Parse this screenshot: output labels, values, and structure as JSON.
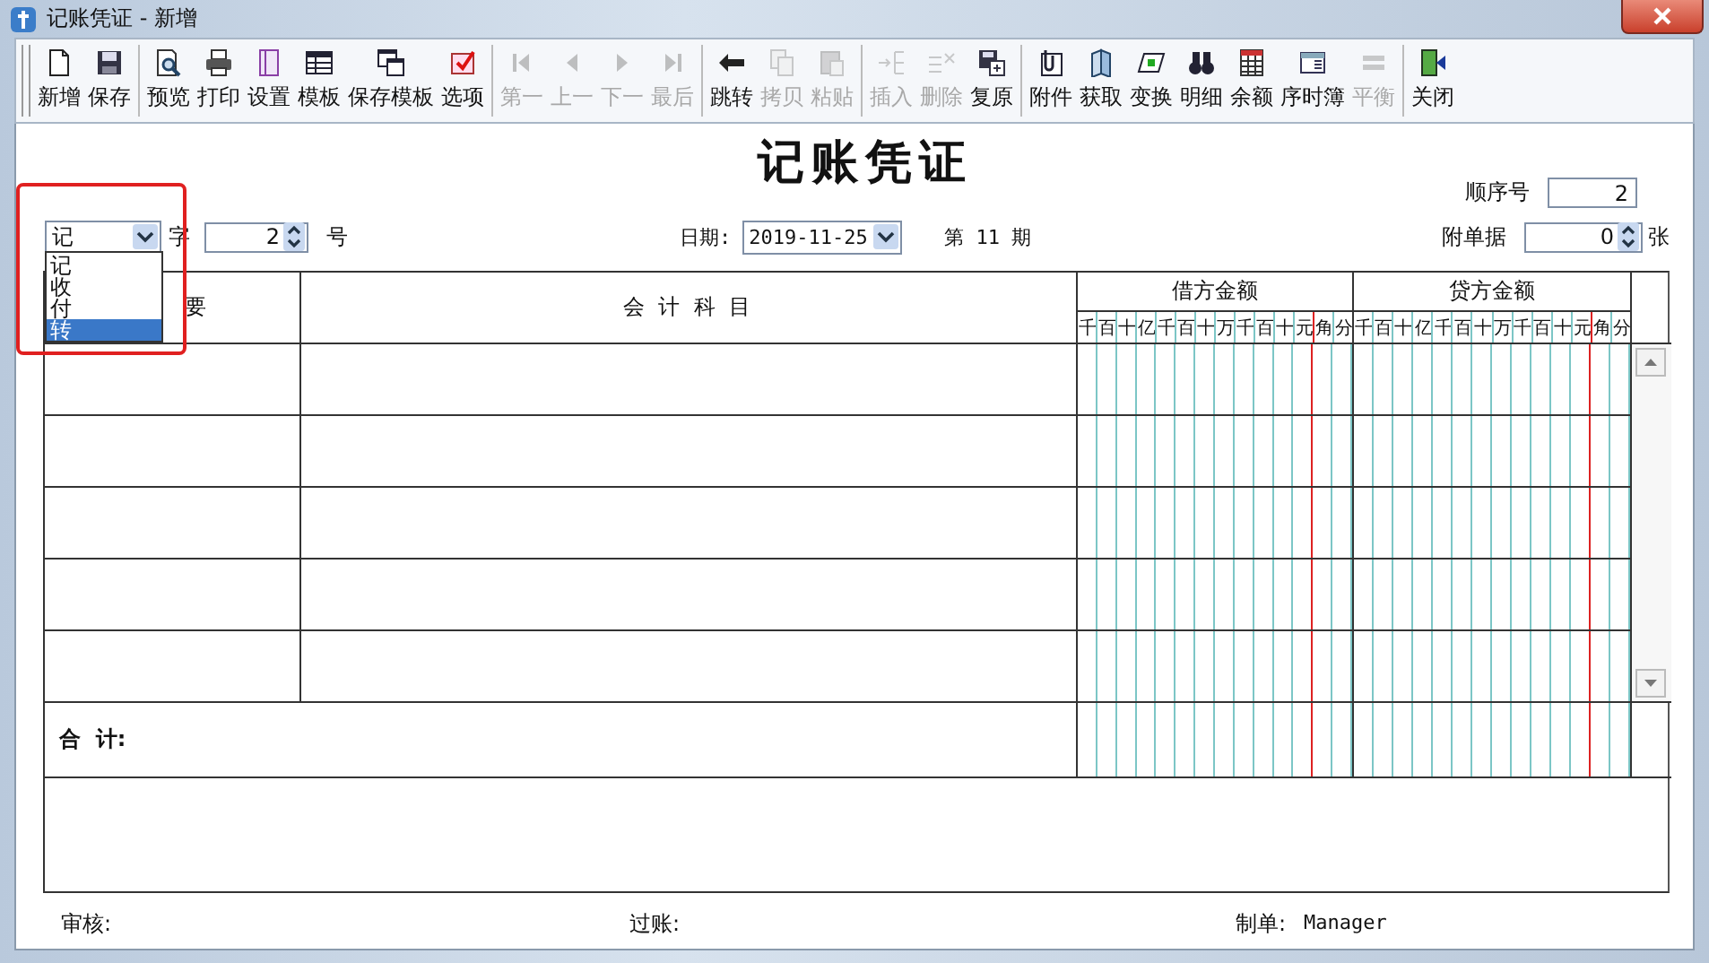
{
  "window": {
    "title": "记账凭证 - 新增"
  },
  "toolbar": {
    "groups": [
      [
        {
          "label": "新增",
          "kind": "new",
          "disabled": false
        },
        {
          "label": "保存",
          "kind": "save",
          "disabled": false
        }
      ],
      [
        {
          "label": "预览",
          "kind": "preview",
          "disabled": false
        },
        {
          "label": "打印",
          "kind": "print",
          "disabled": false
        },
        {
          "label": "设置",
          "kind": "setup",
          "disabled": false
        },
        {
          "label": "模板",
          "kind": "template",
          "disabled": false
        },
        {
          "label": "保存模板",
          "kind": "savetemplate",
          "disabled": false
        },
        {
          "label": "选项",
          "kind": "options",
          "disabled": false
        }
      ],
      [
        {
          "label": "第一",
          "kind": "first",
          "disabled": true
        },
        {
          "label": "上一",
          "kind": "prev",
          "disabled": true
        },
        {
          "label": "下一",
          "kind": "next",
          "disabled": true
        },
        {
          "label": "最后",
          "kind": "last",
          "disabled": true
        }
      ],
      [
        {
          "label": "跳转",
          "kind": "jump",
          "disabled": false
        },
        {
          "label": "拷贝",
          "kind": "copy",
          "disabled": true
        },
        {
          "label": "粘贴",
          "kind": "paste",
          "disabled": true
        }
      ],
      [
        {
          "label": "插入",
          "kind": "insert",
          "disabled": true
        },
        {
          "label": "删除",
          "kind": "delete",
          "disabled": true
        },
        {
          "label": "复原",
          "kind": "restore",
          "disabled": false
        }
      ],
      [
        {
          "label": "附件",
          "kind": "attach",
          "disabled": false
        },
        {
          "label": "获取",
          "kind": "get",
          "disabled": false
        },
        {
          "label": "变换",
          "kind": "exchange",
          "disabled": false
        },
        {
          "label": "明细",
          "kind": "detail",
          "disabled": false
        },
        {
          "label": "余额",
          "kind": "balance",
          "disabled": false
        },
        {
          "label": "序时簿",
          "kind": "journal",
          "disabled": false
        },
        {
          "label": "平衡",
          "kind": "equal",
          "disabled": true
        }
      ],
      [
        {
          "label": "关闭",
          "kind": "close",
          "disabled": false
        }
      ]
    ]
  },
  "voucher": {
    "title": "记账凭证",
    "sequence_label": "顺序号",
    "sequence": "2",
    "attachments_label": "附单据",
    "attachments": "0",
    "attachments_unit": "张",
    "type_value": "记",
    "type_suffix": "字",
    "number": "2",
    "number_suffix": "号",
    "date_label": "日期:",
    "date": "2019-11-25",
    "period": "第 11 期"
  },
  "type_dropdown": {
    "options": [
      {
        "label": "记",
        "selected": false
      },
      {
        "label": "收",
        "selected": false
      },
      {
        "label": "付",
        "selected": false
      },
      {
        "label": "转",
        "selected": true
      }
    ]
  },
  "table": {
    "summary_header": "要",
    "subject_header": "会 计 科 目",
    "money_columns": [
      {
        "label": "借方金额",
        "units": [
          "千",
          "百",
          "十",
          "亿",
          "千",
          "百",
          "十",
          "万",
          "千",
          "百",
          "十",
          "元",
          "角",
          "分"
        ]
      },
      {
        "label": "贷方金额",
        "units": [
          "千",
          "百",
          "十",
          "亿",
          "千",
          "百",
          "十",
          "万",
          "千",
          "百",
          "十",
          "元",
          "角",
          "分"
        ]
      }
    ],
    "total_label": "合  计:"
  },
  "footer": {
    "reviewer_label": "审核:",
    "posting_label": "过账:",
    "maker_label": "制单:",
    "maker": "Manager"
  }
}
